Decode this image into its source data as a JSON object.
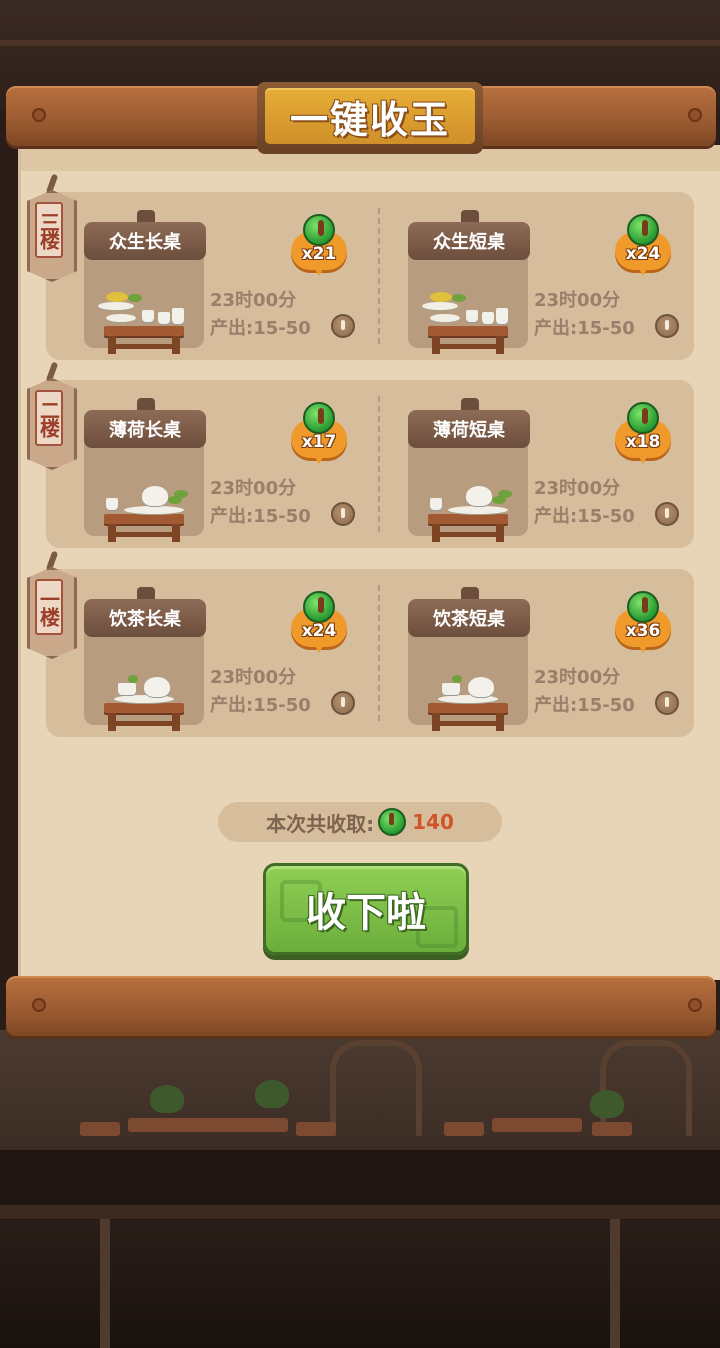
{
  "panel": {
    "title": "一键收玉"
  },
  "floors": [
    {
      "tag": "三楼",
      "items": [
        {
          "name": "众生长桌",
          "jade": "x21",
          "time": "23时00分",
          "output": "产出:15-50",
          "style": "feast"
        },
        {
          "name": "众生短桌",
          "jade": "x24",
          "time": "23时00分",
          "output": "产出:15-50",
          "style": "feast"
        }
      ]
    },
    {
      "tag": "二楼",
      "items": [
        {
          "name": "薄荷长桌",
          "jade": "x17",
          "time": "23时00分",
          "output": "产出:15-50",
          "style": "mint"
        },
        {
          "name": "薄荷短桌",
          "jade": "x18",
          "time": "23时00分",
          "output": "产出:15-50",
          "style": "mint"
        }
      ]
    },
    {
      "tag": "一楼",
      "items": [
        {
          "name": "饮茶长桌",
          "jade": "x24",
          "time": "23时00分",
          "output": "产出:15-50",
          "style": "tea"
        },
        {
          "name": "饮茶短桌",
          "jade": "x36",
          "time": "23时00分",
          "output": "产出:15-50",
          "style": "tea"
        }
      ]
    }
  ],
  "summary": {
    "label": "本次共收取:",
    "total": "140"
  },
  "button": {
    "label": "收下啦"
  },
  "colors": {
    "paper": "#e8d5b8",
    "row_bg": "#d6bd9c",
    "title_gold": "#e6ad36",
    "button_green": "#8fcf55",
    "jade_green": "#2e9f35",
    "badge_orange": "#f09a2b",
    "total_red": "#d2542a"
  },
  "icons": {
    "jade": "jade-coin-icon",
    "coin": "copper-coin-icon"
  }
}
